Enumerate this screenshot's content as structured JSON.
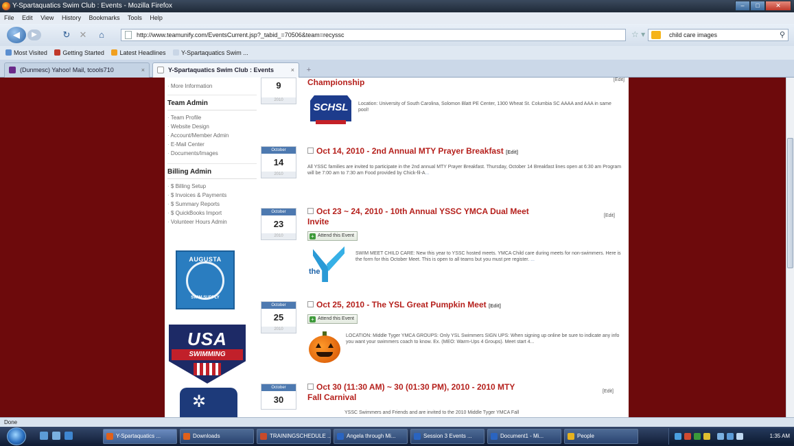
{
  "window": {
    "title": "Y-Spartaquatics Swim Club : Events - Mozilla Firefox",
    "controls": [
      "–",
      "□",
      "✕"
    ]
  },
  "menu": [
    "File",
    "Edit",
    "View",
    "History",
    "Bookmarks",
    "Tools",
    "Help"
  ],
  "nav": {
    "url": "http://www.teamunify.com/EventsCurrent.jsp?_tabid_=70506&team=recyssc",
    "search_value": "child care images"
  },
  "bookmarks": [
    "Most Visited",
    "Getting Started",
    "Latest Headlines",
    "Y-Spartaquatics Swim ..."
  ],
  "tabs": [
    {
      "label": "(Dunmesc) Yahoo! Mail, tcools710"
    },
    {
      "label": "Y-Spartaquatics Swim Club : Events"
    }
  ],
  "sidebar": {
    "top_items": [
      "More Information"
    ],
    "team_admin": {
      "heading": "Team Admin",
      "items": [
        "Team Profile",
        "Website Design",
        "Account/Member Admin",
        "E-Mail Center",
        "Documents/Images"
      ]
    },
    "billing_admin": {
      "heading": "Billing Admin",
      "items": [
        "$ Billing Setup",
        "$ Invoices & Payments",
        "$ Summary Reports",
        "$ QuickBooks Import",
        "Volunteer Hours Admin"
      ]
    },
    "logos": {
      "augusta_top": "AUGUSTA",
      "augusta_bottom": "SWIM SUPPLY",
      "usa": "USA",
      "usa_band": "SWIMMING"
    }
  },
  "events": [
    {
      "month": "",
      "day": "9",
      "year": "2010",
      "title": "Championship",
      "edit": "[Edit]",
      "desc": "Location: University of South Carolina, Solomon Blatt PE Center, 1300 Wheat St. Columbia SC AAAA and AAA in same pool!",
      "logo_text": "SCHSL"
    },
    {
      "month": "October",
      "day": "14",
      "year": "2010",
      "title": "Oct 14, 2010 - 2nd Annual MTY Prayer Breakfast",
      "edit": "[Edit]",
      "desc": "All YSSC families are invited to participate in the 2nd annual MTY Prayer Breakfast. Thursday, October 14 Breakfast lines open at 6:30 am Program will be 7:00 am to 7:30 am Food provided by Chick-fil-A",
      "more": "..."
    },
    {
      "month": "October",
      "day": "23",
      "year": "2010",
      "title_line1": "Oct 23 ~ 24, 2010 - 10th Annual YSSC YMCA Dual Meet",
      "title_line2": "Invite",
      "edit": "[Edit]",
      "attend": "Attend this Event",
      "desc": "SWIM MEET CHILD CARE: New this year to YSSC hosted meets. YMCA Child care during meets for non-swimmers. Here is the form for this October Meet. This is open to all teams but you must pre register.",
      "more": "...",
      "logo_text": "the"
    },
    {
      "month": "October",
      "day": "25",
      "year": "2010",
      "title": "Oct 25, 2010 - The YSL Great Pumpkin Meet",
      "edit": "[Edit]",
      "attend": "Attend this Event",
      "desc": "LOCATION: Middle Tyger YMCA GROUPS: Only YSL Swimmers SIGN UPS: When signing up online be sure to indicate any info you want your swimmers coach to know. Ex. (MEO: Warm-Ups 4 Groups). Meet start 4..."
    },
    {
      "month": "October",
      "day": "30",
      "year": "",
      "title_line1": "Oct 30 (11:30 AM) ~ 30 (01:30 PM), 2010 - 2010 MTY",
      "title_line2": "Fall Carnival",
      "edit": "[Edit]",
      "desc": "YSSC Swimmers and Friends and are invited to the 2010 Middle Tyger YMCA Fall"
    }
  ],
  "status": "Done",
  "taskbar": {
    "tasks": [
      "Y-Spartaquatics ...",
      "Downloads",
      "TRAININGSCHEDULE ...",
      "Angela through Mi...",
      "Session 3 Events ...",
      "Document1 - Mi...",
      "People"
    ],
    "clock": "1:35 AM"
  },
  "colors": {
    "page_background": "#6d0a0c",
    "title_red": "#b5201c",
    "date_header_blue": "#4d79b0"
  }
}
